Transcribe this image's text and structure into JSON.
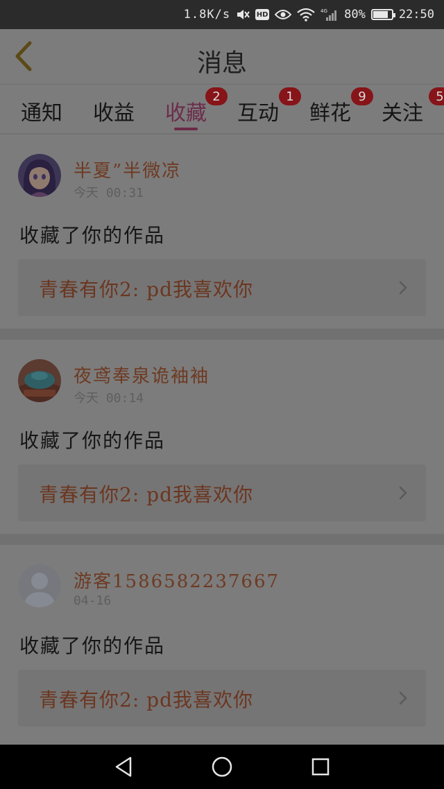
{
  "status_bar": {
    "network_speed": "1.8K/s",
    "hd_label": "HD",
    "signal_type": "4G",
    "battery_percent": "80%",
    "battery_level": 0.8,
    "time": "22:50",
    "icons": [
      "mute-icon",
      "hd-icon",
      "eye-icon",
      "wifi-icon",
      "signal-icon",
      "battery-icon"
    ]
  },
  "header": {
    "title": "消息",
    "back_icon": "chevron-left-icon"
  },
  "tabs": [
    {
      "label": "通知",
      "badge": "",
      "active": false
    },
    {
      "label": "收益",
      "badge": "",
      "active": false
    },
    {
      "label": "收藏",
      "badge": "2",
      "active": true
    },
    {
      "label": "互动",
      "badge": "1",
      "active": false
    },
    {
      "label": "鲜花",
      "badge": "9",
      "active": false
    },
    {
      "label": "关注",
      "badge": "5",
      "active": false
    }
  ],
  "messages": [
    {
      "user": "半夏”半微凉",
      "time": "今天 00:31",
      "action": "收藏了你的作品",
      "work_title": "青春有你2: pd我喜欢你",
      "avatar": "anime-avatar"
    },
    {
      "user": "夜鸢奉泉\u0000",
      "time": "今天 00:14",
      "action": "收藏了你的作品",
      "work_title": "青春有你2: pd我喜欢你",
      "avatar": "photo-avatar"
    },
    {
      "user": "游客1586582237667",
      "time": "04-16",
      "action": "收藏了你的作品",
      "work_title": "青春有你2: pd我喜欢你",
      "avatar": "default-avatar"
    }
  ],
  "nav_bar": {
    "icons": [
      "back-triangle-icon",
      "home-circle-icon",
      "recents-square-icon"
    ]
  },
  "colors": {
    "overlay_background": "#7c7c7c",
    "accent": "#6b2b47",
    "badge": "#861418",
    "name_color": "#6e3a22"
  }
}
